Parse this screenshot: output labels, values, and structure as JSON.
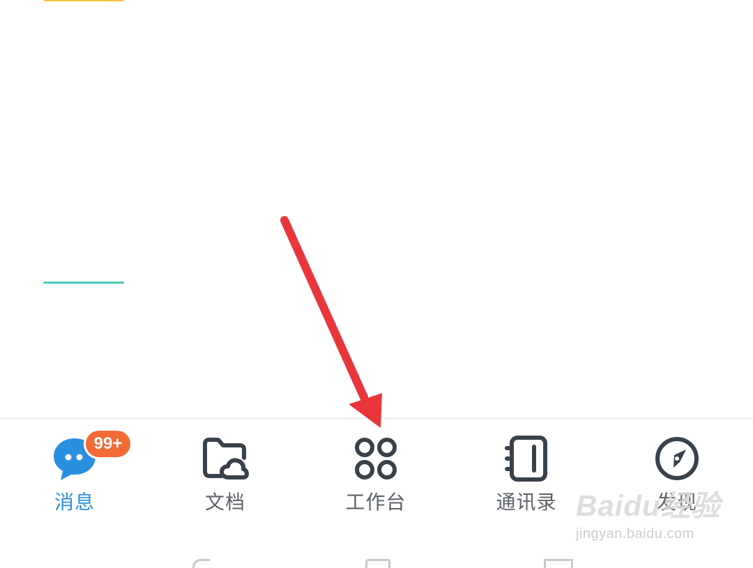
{
  "tabbar": {
    "tabs": [
      {
        "id": "messages",
        "label": "消息",
        "icon": "chat-bubble-icon",
        "active": true,
        "badge": "99+"
      },
      {
        "id": "docs",
        "label": "文档",
        "icon": "cloud-folder-icon",
        "active": false
      },
      {
        "id": "workbench",
        "label": "工作台",
        "icon": "apps-grid-icon",
        "active": false
      },
      {
        "id": "contacts",
        "label": "通讯录",
        "icon": "address-book-icon",
        "active": false
      },
      {
        "id": "discover",
        "label": "发现",
        "icon": "compass-icon",
        "active": false
      }
    ]
  },
  "colors": {
    "active": "#2b8fe0",
    "inactive": "#5c6268",
    "icon_stroke": "#39414a",
    "badge": "#f26a36",
    "arrow": "#e8363a"
  },
  "watermark": {
    "logo": "Baidu经验",
    "url": "jingyan.baidu.com"
  }
}
